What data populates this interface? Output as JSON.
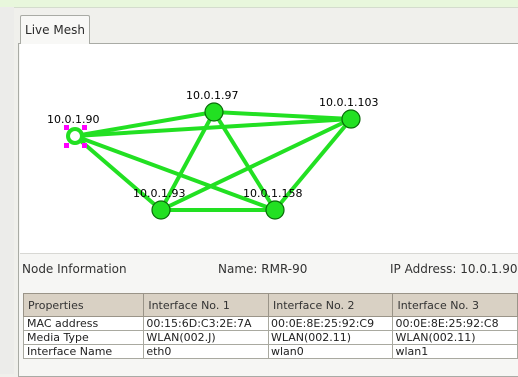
{
  "tabs": [
    {
      "label": "Live Mesh"
    }
  ],
  "mesh": {
    "nodes": [
      {
        "id": "10.0.1.90",
        "label": "10.0.1.90",
        "selected": true
      },
      {
        "id": "10.0.1.97",
        "label": "10.0.1.97"
      },
      {
        "id": "10.0.1.103",
        "label": "10.0.1.103"
      },
      {
        "id": "10.0.1.93",
        "label": "10.0.1.93"
      },
      {
        "id": "10.0.1.158",
        "label": "10.0.1.158"
      }
    ],
    "links": [
      [
        "10.0.1.90",
        "10.0.1.97"
      ],
      [
        "10.0.1.90",
        "10.0.1.103"
      ],
      [
        "10.0.1.90",
        "10.0.1.93"
      ],
      [
        "10.0.1.90",
        "10.0.1.158"
      ],
      [
        "10.0.1.97",
        "10.0.1.103"
      ],
      [
        "10.0.1.97",
        "10.0.1.93"
      ],
      [
        "10.0.1.97",
        "10.0.1.158"
      ],
      [
        "10.0.1.103",
        "10.0.1.93"
      ],
      [
        "10.0.1.103",
        "10.0.1.158"
      ],
      [
        "10.0.1.93",
        "10.0.1.158"
      ]
    ],
    "colors": {
      "link": "#22e022",
      "node": "#22e022",
      "node_stroke": "#0a6a0a",
      "selection": "#ff00ff"
    }
  },
  "node_info": {
    "title": "Node Information",
    "name": "Name: RMR-90",
    "ip": "IP Address: 10.0.1.90"
  },
  "properties_table": {
    "headers": [
      "Properties",
      "Interface No. 1",
      "Interface No. 2",
      "Interface No. 3"
    ],
    "rows": [
      [
        "MAC address",
        "00:15:6D:C3:2E:7A",
        "00:0E:8E:25:92:C9",
        "00:0E:8E:25:92:C8"
      ],
      [
        "Media Type",
        "WLAN(002.J)",
        "WLAN(002.11)",
        "WLAN(002.11)"
      ],
      [
        "Interface Name",
        "eth0",
        "wlan0",
        "wlan1"
      ]
    ]
  }
}
